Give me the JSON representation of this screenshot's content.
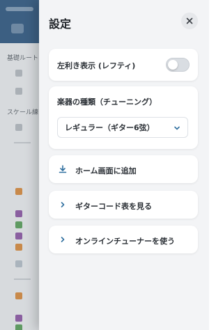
{
  "background": {
    "section_label_1": "基礎ルート",
    "section_label_2": "スケール練"
  },
  "settings_panel": {
    "title": "設定",
    "close_label": "×",
    "lefty": {
      "label": "左利き表示 (レフティ)",
      "enabled": false
    },
    "instrument": {
      "label": "楽器の種類（チューニング）",
      "selected": "レギュラー（ギター6弦）"
    },
    "actions": [
      {
        "label": "ホーム画面に追加",
        "icon": "download-icon"
      },
      {
        "label": "ギターコード表を見る",
        "icon": "chevron-right-icon"
      },
      {
        "label": "オンラインチューナーを使う",
        "icon": "chevron-right-icon"
      }
    ]
  },
  "colors": {
    "accent": "#2f6f9f",
    "panel_bg": "#f3f4f6",
    "card_bg": "#ffffff",
    "header_bg": "#3c5f82"
  }
}
